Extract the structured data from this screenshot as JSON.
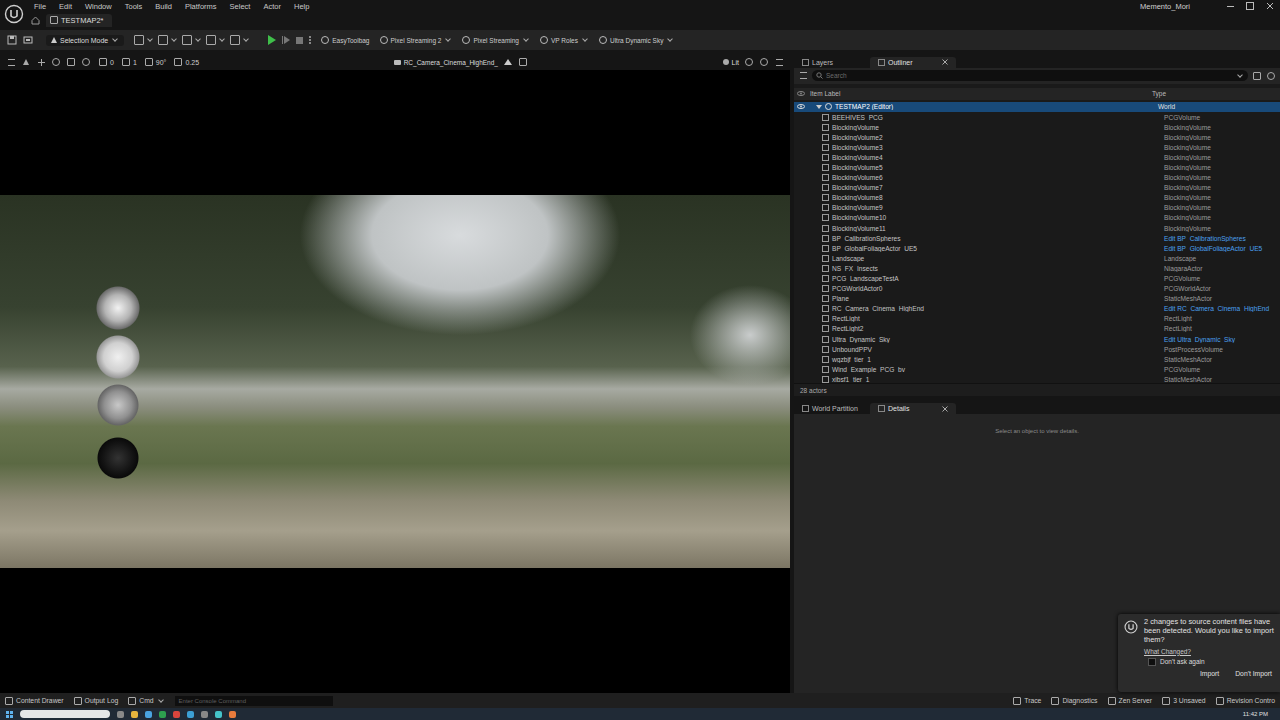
{
  "app": {
    "user": "Memento_Mori",
    "level_tab": "TESTMAP2*"
  },
  "menu": [
    "File",
    "Edit",
    "Window",
    "Tools",
    "Build",
    "Platforms",
    "Select",
    "Actor",
    "Help"
  ],
  "toolbar": {
    "mode": "Selection Mode",
    "plugins": [
      {
        "label": "EasyToolbag",
        "dropdown": false
      },
      {
        "label": "Pixel Streaming 2",
        "dropdown": true
      },
      {
        "label": "Pixel Streaming",
        "dropdown": true
      },
      {
        "label": "VP Roles",
        "dropdown": true
      },
      {
        "label": "Ultra Dynamic Sky",
        "dropdown": true
      }
    ]
  },
  "viewport": {
    "snaps": [
      "0",
      "1",
      "90°",
      "0.25"
    ],
    "camera": "RC_Camera_Cinema_HighEnd_",
    "view_mode": "Lit"
  },
  "outliner": {
    "tabs": [
      {
        "label": "Layers",
        "selected": false,
        "closable": false
      },
      {
        "label": "Outliner",
        "selected": true,
        "closable": true
      }
    ],
    "search_placeholder": "Search",
    "columns": [
      "Item Label",
      "Type"
    ],
    "rows": [
      {
        "label": "TESTMAP2 (Editor)",
        "type": "World",
        "kind": "world",
        "link": false,
        "selected": true,
        "expanded": true
      },
      {
        "label": "BEEHIVES_PCG",
        "type": "PCGVolume",
        "kind": "actor",
        "link": false,
        "selected": false,
        "expanded": false
      },
      {
        "label": "BlockingVolume",
        "type": "BlockingVolume",
        "kind": "actor",
        "link": false,
        "selected": false,
        "expanded": false
      },
      {
        "label": "BlockingVolume2",
        "type": "BlockingVolume",
        "kind": "actor",
        "link": false,
        "selected": false,
        "expanded": false
      },
      {
        "label": "BlockingVolume3",
        "type": "BlockingVolume",
        "kind": "actor",
        "link": false,
        "selected": false,
        "expanded": false
      },
      {
        "label": "BlockingVolume4",
        "type": "BlockingVolume",
        "kind": "actor",
        "link": false,
        "selected": false,
        "expanded": false
      },
      {
        "label": "BlockingVolume5",
        "type": "BlockingVolume",
        "kind": "actor",
        "link": false,
        "selected": false,
        "expanded": false
      },
      {
        "label": "BlockingVolume6",
        "type": "BlockingVolume",
        "kind": "actor",
        "link": false,
        "selected": false,
        "expanded": false
      },
      {
        "label": "BlockingVolume7",
        "type": "BlockingVolume",
        "kind": "actor",
        "link": false,
        "selected": false,
        "expanded": false
      },
      {
        "label": "BlockingVolume8",
        "type": "BlockingVolume",
        "kind": "actor",
        "link": false,
        "selected": false,
        "expanded": false
      },
      {
        "label": "BlockingVolume9",
        "type": "BlockingVolume",
        "kind": "actor",
        "link": false,
        "selected": false,
        "expanded": false
      },
      {
        "label": "BlockingVolume10",
        "type": "BlockingVolume",
        "kind": "actor",
        "link": false,
        "selected": false,
        "expanded": false
      },
      {
        "label": "BlockingVolume11",
        "type": "BlockingVolume",
        "kind": "actor",
        "link": false,
        "selected": false,
        "expanded": false
      },
      {
        "label": "BP_CalibrationSpheres",
        "type": "Edit BP_CalibrationSpheres",
        "kind": "actor",
        "link": true,
        "selected": false,
        "expanded": false
      },
      {
        "label": "BP_GlobalFoliageActor_UE5",
        "type": "Edit BP_GlobalFoliageActor_UE5",
        "kind": "actor",
        "link": true,
        "selected": false,
        "expanded": false
      },
      {
        "label": "Landscape",
        "type": "Landscape",
        "kind": "actor",
        "link": false,
        "selected": false,
        "expanded": false
      },
      {
        "label": "NS_FX_Insects",
        "type": "NiagaraActor",
        "kind": "actor",
        "link": false,
        "selected": false,
        "expanded": false
      },
      {
        "label": "PCG_LandscapeTestA",
        "type": "PCGVolume",
        "kind": "actor",
        "link": false,
        "selected": false,
        "expanded": false
      },
      {
        "label": "PCGWorldActor0",
        "type": "PCGWorldActor",
        "kind": "actor",
        "link": false,
        "selected": false,
        "expanded": false
      },
      {
        "label": "Plane",
        "type": "StaticMeshActor",
        "kind": "actor",
        "link": false,
        "selected": false,
        "expanded": false
      },
      {
        "label": "RC_Camera_Cinema_HighEnd_",
        "type": "Edit RC_Camera_Cinema_HighEnd_",
        "kind": "actor",
        "link": true,
        "selected": false,
        "expanded": false
      },
      {
        "label": "RectLight",
        "type": "RectLight",
        "kind": "actor",
        "link": false,
        "selected": false,
        "expanded": false
      },
      {
        "label": "RectLight2",
        "type": "RectLight",
        "kind": "actor",
        "link": false,
        "selected": false,
        "expanded": false
      },
      {
        "label": "Ultra_Dynamic_Sky",
        "type": "Edit Ultra_Dynamic_Sky",
        "kind": "actor",
        "link": true,
        "selected": false,
        "expanded": false
      },
      {
        "label": "UnboundPPV",
        "type": "PostProcessVolume",
        "kind": "actor",
        "link": false,
        "selected": false,
        "expanded": false
      },
      {
        "label": "wgzbjf_tier_1",
        "type": "StaticMeshActor",
        "kind": "actor",
        "link": false,
        "selected": false,
        "expanded": false
      },
      {
        "label": "Wind_Example_PCG_bv",
        "type": "PCGVolume",
        "kind": "actor",
        "link": false,
        "selected": false,
        "expanded": false
      },
      {
        "label": "xibsf1_tier_1",
        "type": "StaticMeshActor",
        "kind": "actor",
        "link": false,
        "selected": false,
        "expanded": false
      }
    ],
    "count": "28 actors"
  },
  "details": {
    "tabs": [
      {
        "label": "World Partition",
        "selected": false,
        "closable": false
      },
      {
        "label": "Details",
        "selected": true,
        "closable": true
      }
    ],
    "empty": "Select an object to view details."
  },
  "notification": {
    "message": "2 changes to source content files have been detected. Would you like to import them?",
    "link": "What Changed?",
    "checkbox": {
      "label": "Don't ask again",
      "checked": false
    },
    "buttons": [
      "Import",
      "Don't Import"
    ]
  },
  "status_bar": {
    "left": [
      "Content Drawer",
      "Output Log"
    ],
    "cmd": "Cmd",
    "console_placeholder": "Enter Console Command",
    "right": [
      "Trace",
      "Diagnostics",
      "Zen Server",
      "3 Unsaved",
      "Revision Contro"
    ]
  },
  "taskbar": {
    "time": "11:42 PM"
  }
}
